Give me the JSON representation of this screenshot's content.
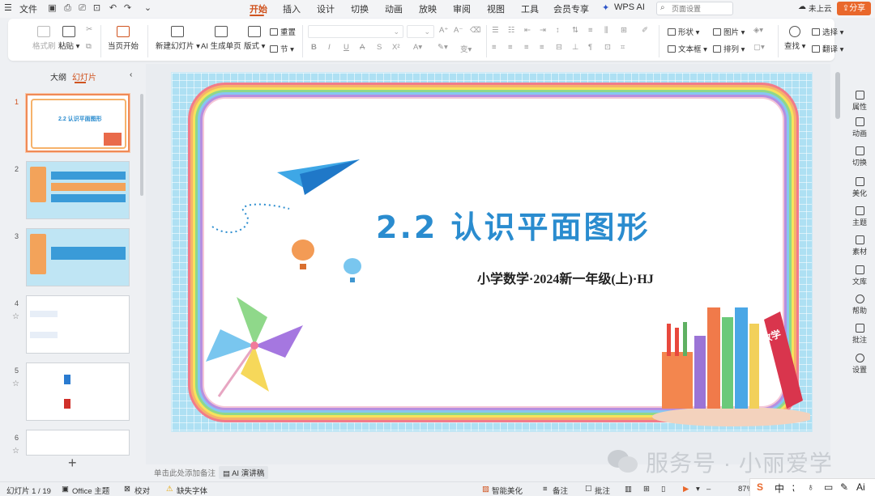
{
  "titlebar": {
    "menu_label": "文件",
    "tabs": [
      "开始",
      "插入",
      "设计",
      "切换",
      "动画",
      "放映",
      "审阅",
      "视图",
      "工具",
      "会员专享"
    ],
    "wps_ai": "WPS AI",
    "search_placeholder": "页面设置",
    "cloud": "未上云",
    "share": "分享"
  },
  "ribbon": {
    "format_painter": "格式刷",
    "paste": "粘贴",
    "from_current": "当页开始",
    "new_slide": "新建幻灯片",
    "ai_page": "AI 生成单页",
    "layout": "版式",
    "reset": "重置",
    "section": "节",
    "shape": "形状",
    "picture": "图片",
    "textbox": "文本框",
    "arrange": "排列",
    "find": "查找",
    "select": "选择",
    "translate": "翻译"
  },
  "panel": {
    "tab_outline": "大纲",
    "tab_slides": "幻灯片",
    "slide_numbers": [
      "1",
      "2",
      "3",
      "4",
      "5",
      "6"
    ]
  },
  "slide": {
    "title": "2.2 认识平面图形",
    "subtitle": "小学数学·2024新一年级(上)·HJ",
    "book_label": "数学"
  },
  "notes": {
    "placeholder": "单击此处添加备注",
    "ai_script": "AI 演讲稿"
  },
  "status": {
    "slide_count": "幻灯片 1 / 19",
    "theme": "Office 主题",
    "proof": "校对",
    "missing_font": "缺失字体",
    "beautify": "智能美化",
    "notes": "备注",
    "comments": "批注",
    "zoom": "87%"
  },
  "right_panel": [
    "属性",
    "动画",
    "切换",
    "美化",
    "主题",
    "素材",
    "文库",
    "帮助",
    "批注",
    "设置"
  ],
  "watermark": "服务号 · 小丽爱学",
  "ime": {
    "zh": "中",
    "ai": "Ai"
  }
}
